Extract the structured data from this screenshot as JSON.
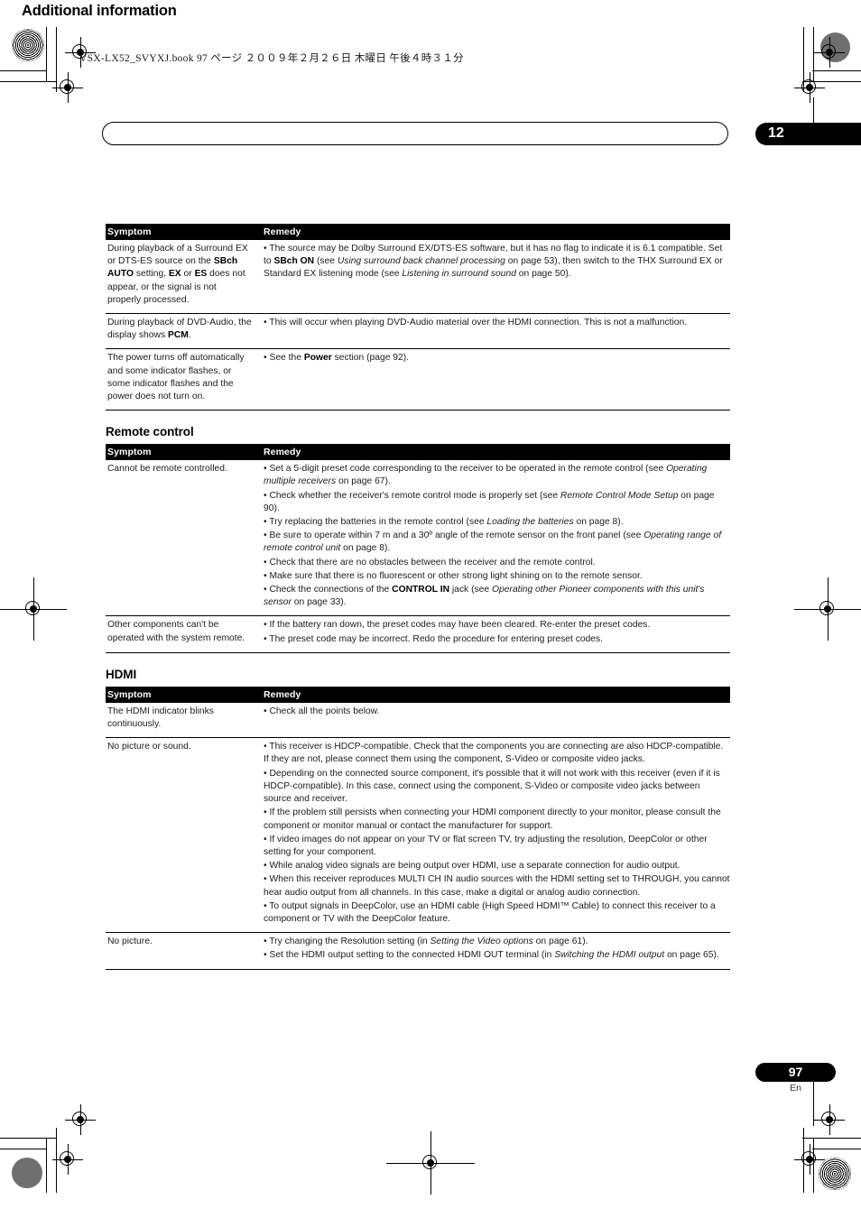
{
  "print_marks": {
    "file_header": "VSX-LX52_SVYXJ.book   97 ページ   ２００９年２月２６日   木曜日   午後４時３１分"
  },
  "runhead": {
    "title": "Additional information",
    "chapter_number": "12"
  },
  "footer": {
    "page_number": "97",
    "language_code": "En"
  },
  "table_headers": {
    "symptom": "Symptom",
    "remedy": "Remedy"
  },
  "sections": [
    {
      "heading": null,
      "rows": [
        {
          "symptom_html": "During playback of a Surround EX or DTS-ES source on the <b class=\"b\">SBch AUTO</b> setting, <b class=\"b\">EX</b> or <b class=\"b\">ES</b> does not appear, or the signal is not properly processed.",
          "remedy_html": "<span class=\"bullet-line\">• The source may be Dolby Surround EX/DTS-ES software, but it has no flag to indicate it is 6.1 compatible. Set to <b class=\"b\">SBch ON</b> (see <i class=\"i\">Using surround back channel processing</i> on page 53), then switch to the THX Surround EX or Standard EX listening mode (see <i class=\"i\">Listening in surround sound</i> on page 50).</span>"
        },
        {
          "symptom_html": "During playback of DVD-Audio, the display shows <b class=\"b\">PCM</b>.",
          "remedy_html": "<span class=\"bullet-line\">• This will occur when playing DVD-Audio material over the HDMI connection. This is not a malfunction.</span>"
        },
        {
          "symptom_html": "The power turns off automatically and some indicator flashes, or some indicator flashes and the power does not turn on.",
          "remedy_html": "<span class=\"bullet-line\">• See the <b class=\"b\">Power</b> section (page 92).</span>",
          "last": true
        }
      ]
    },
    {
      "heading": "Remote control",
      "rows": [
        {
          "symptom_html": "Cannot be remote controlled.",
          "remedy_html": "<span class=\"bullet-line\">• Set a 5-digit preset code corresponding to the receiver to be operated in the remote control (see <i class=\"i\">Operating multiple receivers</i> on page 67).</span><span class=\"bullet-line\">• Check whether the receiver's remote control mode is properly set (see <i class=\"i\">Remote Control Mode Setup</i> on page 90).</span><span class=\"bullet-line\">• Try replacing the batteries in the remote control (see <i class=\"i\">Loading the batteries</i> on page 8).</span><span class=\"bullet-line\">• Be sure to operate within 7 m and a 30º angle of the remote sensor on the front panel (see <i class=\"i\">Operating range of remote control unit</i> on page 8).</span><span class=\"bullet-line\">• Check that there are no obstacles between the receiver and the remote control.</span><span class=\"bullet-line\">• Make sure that there is no fluorescent or other strong light shining on to the remote sensor.</span><span class=\"bullet-line\">• Check the connections of the <b class=\"b\">CONTROL IN</b> jack (see <i class=\"i\">Operating other Pioneer components with this unit's sensor</i> on page 33).</span>"
        },
        {
          "symptom_html": "Other components can't be operated with the system remote.",
          "remedy_html": "<span class=\"bullet-line\">• If the battery ran down, the preset codes may have been cleared. Re-enter the preset codes.</span><span class=\"bullet-line\">• The preset code may be incorrect. Redo the procedure for entering preset codes.</span>",
          "last": true
        }
      ]
    },
    {
      "heading": "HDMI",
      "rows": [
        {
          "symptom_html": "The HDMI indicator blinks continuously.",
          "remedy_html": "<span class=\"bullet-line\">• Check all the points below.</span>"
        },
        {
          "symptom_html": "No picture or sound.",
          "remedy_html": "<span class=\"bullet-line\">• This receiver is HDCP-compatible. Check that the components you are connecting are also HDCP-compatible. If they are not, please connect them using the component, S-Video or composite video jacks.</span><span class=\"bullet-line\">• Depending on the connected source component, it's possible that it will not work with this receiver (even if it is HDCP-compatible). In this case, connect using the component, S-Video or composite video jacks between source and receiver.</span><span class=\"bullet-line\">• If the problem still persists when connecting your HDMI component directly to your monitor, please consult the component or monitor manual or contact the manufacturer for support.</span><span class=\"bullet-line\">• If video images do not appear on your TV or flat screen TV, try adjusting the resolution, DeepColor or other setting for your component.</span><span class=\"bullet-line\">• While analog video signals are being output over HDMI, use a separate connection for audio output.</span><span class=\"bullet-line\">• When this receiver reproduces MULTI CH IN audio sources with the HDMI setting set to THROUGH, you cannot hear audio output from all channels. In this case, make a digital or analog audio connection.</span><span class=\"bullet-line\">• To output signals in DeepColor, use an HDMI cable (High Speed HDMI™ Cable) to connect this receiver to a component or TV with the DeepColor feature.</span>"
        },
        {
          "symptom_html": "No picture.",
          "remedy_html": "<span class=\"bullet-line\">• Try changing the Resolution setting (in <i class=\"i\">Setting the Video options</i> on page 61).</span><span class=\"bullet-line\">• Set the HDMI output setting to the connected HDMI OUT terminal (in <i class=\"i\">Switching the HDMI output</i> on page 65).</span>",
          "last": true
        }
      ]
    }
  ]
}
